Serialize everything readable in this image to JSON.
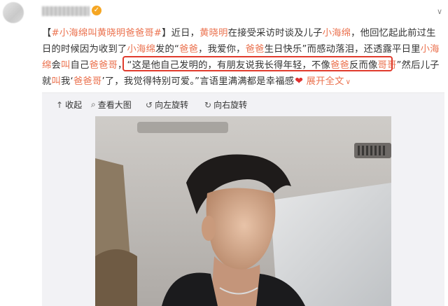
{
  "header": {
    "username": "██████",
    "verified_icon": "verified-badge-icon",
    "menu_icon": "chevron-down-icon",
    "menu_glyph": "∨"
  },
  "post": {
    "l1": {
      "p0": "【",
      "topic": "#小海绵叫黄晓明爸爸哥#",
      "p1": "】近日，",
      "name1": "黄晓明",
      "p2": "在接受采访时谈及儿子",
      "name2": "小海绵",
      "p3": "，他回忆起此前过生"
    },
    "l2": {
      "p0": "日的时候因为收到了",
      "name": "小海绵",
      "p1": "发的“",
      "k1": "爸爸",
      "p2": "，我爱你，",
      "k2": "爸爸",
      "p3": "生日快乐”而感动落泪，还透露平日里",
      "name2": "小海"
    },
    "l3": {
      "name": "绵",
      "p0": "会",
      "k1": "叫",
      "p1": "自己",
      "k2": "爸爸哥",
      "p2": "，“这是他自己发明的，有朋友说我长得年轻，不像",
      "k3": "爸爸",
      "p3": "反而像",
      "k4": "哥哥",
      "p4": "”然后儿子"
    },
    "l4": {
      "p0": "就",
      "k1": "叫",
      "p1": "我‘",
      "k2": "爸爸哥",
      "p2": "’了，我觉得特别可爱。”言语里满满都是幸福感",
      "heart": "❤",
      "more": "展开全文",
      "more_icon": "∨"
    }
  },
  "toolbar": {
    "collapse": "收起",
    "collapse_icon": "↑",
    "view_large": "查看大图",
    "view_large_icon": "⌕",
    "rotate_left": "向左旋转",
    "rotate_left_icon": "↺",
    "rotate_right": "向右旋转",
    "rotate_right_icon": "↻"
  },
  "colors": {
    "accent": "#eb7350",
    "highlight_box": "#e03b2d",
    "toolbar_bg": "#f2f2f5"
  }
}
